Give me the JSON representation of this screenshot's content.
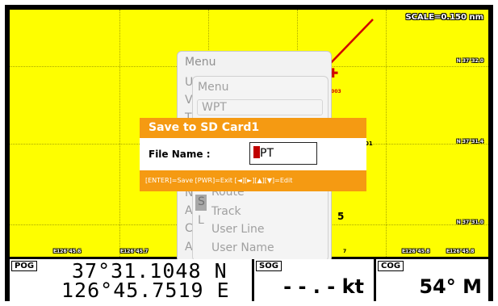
{
  "chart": {
    "scale": "SCALE=0.150 nm",
    "latitudes": [
      "N 37°32.0",
      "N 37°31.4",
      "N 37°31.0"
    ],
    "longitudes": [
      "E126°45.6",
      "E126°45.7",
      "E126°45.8",
      "E126°45.8"
    ],
    "waypoint_label": "0003",
    "fragment_01": "01",
    "fragment_5": "5",
    "fragment_7": "7",
    "colors": {
      "background": "#fefe00",
      "track": "#d00000",
      "accent": "#f59a12"
    }
  },
  "menu_back": {
    "title": "Menu",
    "items": [
      "U",
      "V",
      "T",
      "N",
      "A",
      "Car",
      "Adv"
    ]
  },
  "menu_front": {
    "title": "Menu",
    "items_boxed": [
      "WPT",
      ""
    ],
    "items_plain": [
      "Route",
      "Track",
      "User Line",
      "User Name"
    ],
    "selected_stub": "S",
    "stub_L": "L"
  },
  "dialog": {
    "title": "Save to SD Card1",
    "file_name_label": "File Name :",
    "file_name_value": "PT",
    "help": "[ENTER]=Save [PWR]=Exit [◄][►][▲][▼]=Edit"
  },
  "status": {
    "pog_label": "POG",
    "pog_lat": "37°31.1048 N",
    "pog_lon": "126°45.7519 E",
    "sog_label": "SOG",
    "sog_value": "- - . - kt",
    "cog_label": "COG",
    "cog_value": "54° M"
  }
}
